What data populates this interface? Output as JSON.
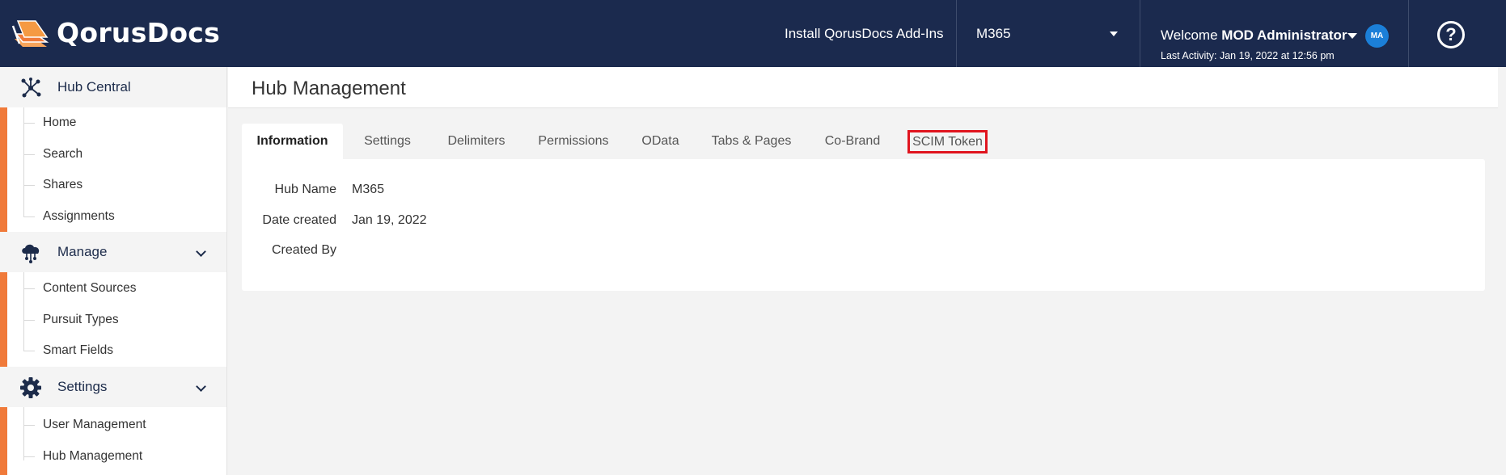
{
  "header": {
    "brand": "QorusDocs",
    "install_label": "Install QorusDocs Add-Ins",
    "hub_selected": "M365",
    "welcome_prefix": "Welcome",
    "user_name": "MOD Administrator",
    "avatar_initials": "MA",
    "last_activity": "Last Activity: Jan 19, 2022 at 12:56 pm",
    "help_glyph": "?"
  },
  "sidebar": {
    "sections": [
      {
        "label": "Hub Central",
        "icon": "hub-network-icon",
        "items": [
          "Home",
          "Search",
          "Shares",
          "Assignments"
        ]
      },
      {
        "label": "Manage",
        "icon": "cloud-network-icon",
        "items": [
          "Content Sources",
          "Pursuit Types",
          "Smart Fields"
        ]
      },
      {
        "label": "Settings",
        "icon": "gear-icon",
        "items": [
          "User Management",
          "Hub Management"
        ]
      }
    ]
  },
  "main": {
    "title": "Hub Management",
    "tabs": [
      {
        "label": "Information"
      },
      {
        "label": "Settings"
      },
      {
        "label": "Delimiters"
      },
      {
        "label": "Permissions"
      },
      {
        "label": "OData"
      },
      {
        "label": "Tabs & Pages"
      },
      {
        "label": "Co-Brand"
      },
      {
        "label": "SCIM Token"
      }
    ],
    "info": {
      "hub_name_label": "Hub Name",
      "hub_name_value": "M365",
      "date_created_label": "Date created",
      "date_created_value": "Jan 19, 2022",
      "created_by_label": "Created By",
      "created_by_value": ""
    }
  },
  "colors": {
    "header_bg": "#1b2a4e",
    "accent": "#f07a3a",
    "avatar": "#1b7fd8",
    "highlight": "#e0141e"
  }
}
